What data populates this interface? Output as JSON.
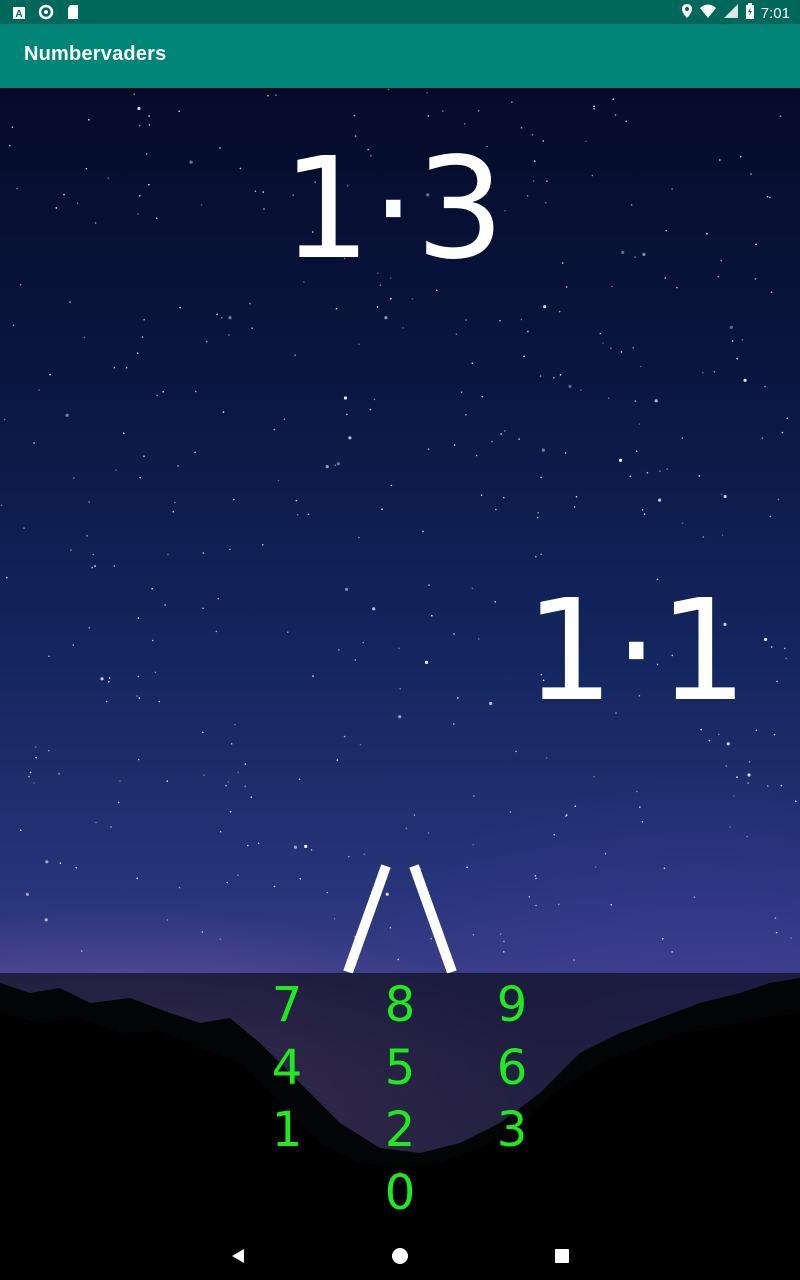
{
  "status_bar": {
    "time": "7:01",
    "left_icons": [
      "a-icon",
      "sync-icon",
      "sd-card-icon"
    ],
    "right_icons": [
      "location-icon",
      "wifi-icon",
      "signal-icon",
      "battery-icon"
    ]
  },
  "app_bar": {
    "title": "Numbervaders",
    "color": "#008577",
    "status_color": "#00685b"
  },
  "game": {
    "enemies": [
      "1·3",
      "1·1"
    ],
    "ship_label": "/\\"
  },
  "keypad": {
    "color": "#1eea1e",
    "rows": [
      [
        "7",
        "8",
        "9"
      ],
      [
        "4",
        "5",
        "6"
      ],
      [
        "1",
        "2",
        "3"
      ],
      [
        "0"
      ]
    ]
  },
  "nav_bar": {
    "icons": [
      "back-icon",
      "home-icon",
      "recents-icon"
    ]
  }
}
